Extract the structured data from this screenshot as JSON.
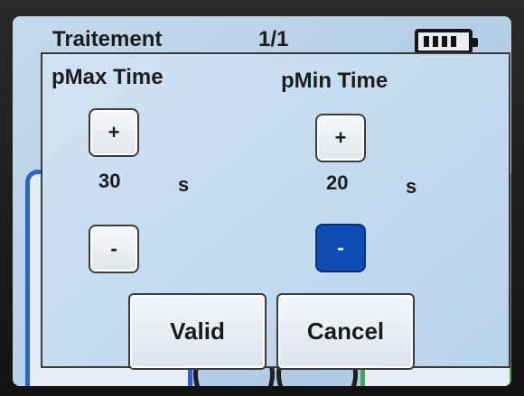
{
  "background": {
    "title": "Traitement",
    "page_indicator": "1/1",
    "battery_icon": "battery-icon"
  },
  "dialog": {
    "pmax": {
      "title": "pMax Time",
      "plus_label": "+",
      "value": "30",
      "unit": "s",
      "minus_label": "-"
    },
    "pmin": {
      "title": "pMin Time",
      "plus_label": "+",
      "value": "20",
      "unit": "s",
      "minus_label": "-",
      "minus_pressed": true
    },
    "valid_label": "Valid",
    "cancel_label": "Cancel"
  },
  "colors": {
    "pressed_button": "#0b4db3",
    "blue_panel": "#2d63c8",
    "green_panel": "#3aac4d"
  }
}
